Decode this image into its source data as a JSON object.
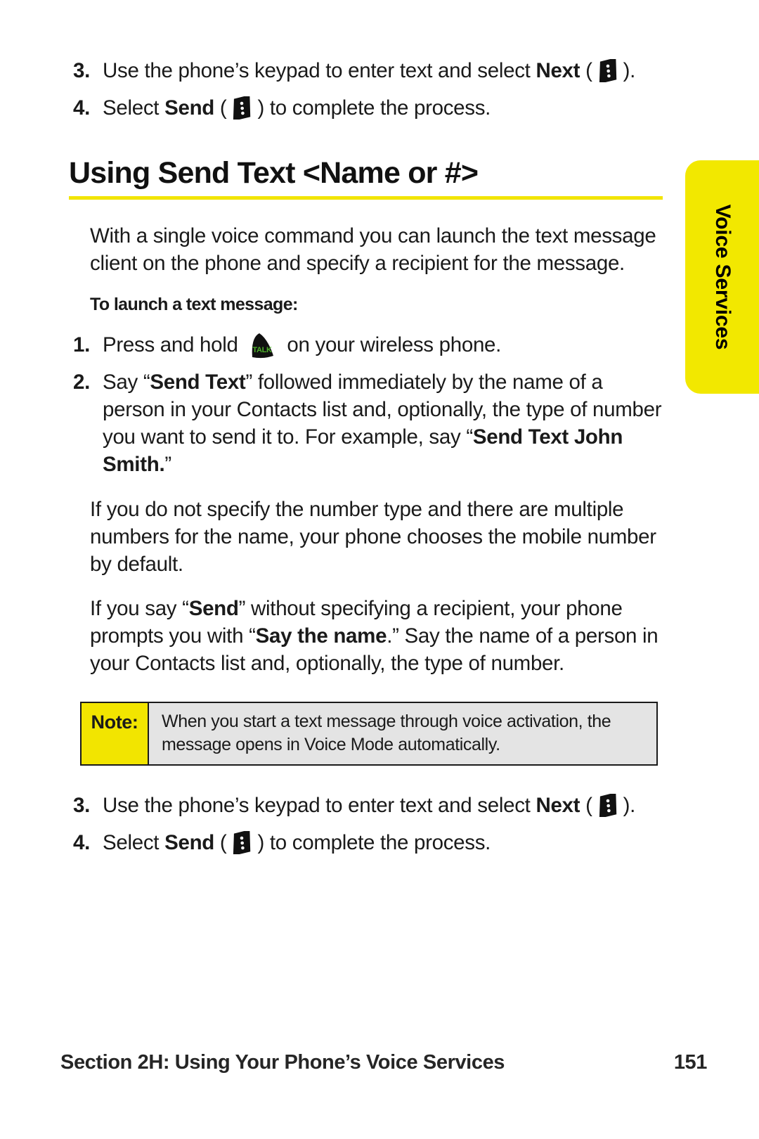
{
  "side_tab": {
    "label": "Voice Services",
    "background": "#f2e800"
  },
  "top_steps": [
    {
      "number": "3.",
      "text_before": "Use the phone’s keypad to enter text and select ",
      "bold": "Next",
      "text_after": " (",
      "icon": "softkey-icon",
      "text_end": ")."
    },
    {
      "number": "4.",
      "text_before": "Select ",
      "bold": "Send",
      "text_after": " (",
      "icon": "softkey-icon",
      "text_end": ") to complete the process."
    }
  ],
  "heading": {
    "title": "Using Send Text <Name or #>",
    "rule_color": "#f2e500"
  },
  "intro_paragraph": "With a single voice command you can launch the text message client on the phone and specify a recipient for the message.",
  "subhead": "To launch a text message:",
  "launch_steps": [
    {
      "number": "1.",
      "text_before": "Press and hold ",
      "icon": "talk-key-icon",
      "text_after": " on your wireless phone."
    },
    {
      "number": "2.",
      "part1": "Say “",
      "bold1": "Send Text",
      "part2": "” followed immediately by the name of a person in your Contacts list and, optionally, the type of number you want to send it to. For example, say “",
      "bold2": "Send Text John Smith.",
      "part3": "”"
    }
  ],
  "paragraphs": [
    {
      "part1": "If you do not specify the number type and there are multiple numbers for the name, your phone chooses the mobile number by default."
    },
    {
      "part1": "If you say “",
      "bold1": "Send",
      "part2": "” without specifying a recipient, your phone prompts you with “",
      "bold2": "Say the name",
      "part3": ".” Say the name of a person in your Contacts list and, optionally, the type of number."
    }
  ],
  "note": {
    "tag": "Note:",
    "text": "When you start a text message through voice activation, the message opens in Voice Mode automatically.",
    "tag_background": "#f2e500",
    "body_background": "#e4e4e4"
  },
  "bottom_steps": [
    {
      "number": "3.",
      "text_before": "Use the phone’s keypad to enter text and select ",
      "bold": "Next",
      "text_after": " (",
      "icon": "softkey-icon",
      "text_end": ")."
    },
    {
      "number": "4.",
      "text_before": "Select ",
      "bold": "Send",
      "text_after": " (",
      "icon": "softkey-icon",
      "text_end": ") to complete the process."
    }
  ],
  "footer": {
    "section": "Section 2H: Using Your Phone’s Voice Services",
    "page_number": "151"
  },
  "icons": {
    "talk_label": "TALK",
    "talk_text_color": "#4caf2a",
    "key_color": "#111111"
  }
}
